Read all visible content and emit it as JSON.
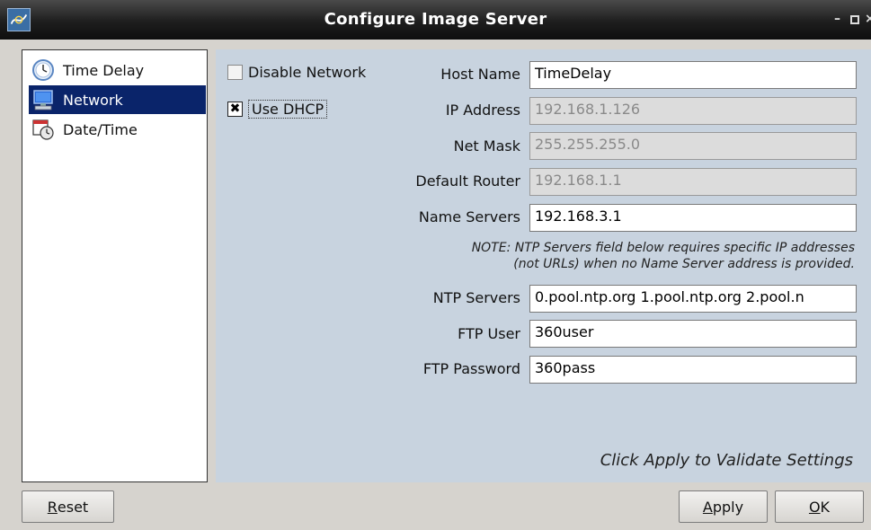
{
  "window": {
    "title": "Configure Image Server",
    "controls": {
      "minimize": "–",
      "maximize": "□",
      "close": "×"
    }
  },
  "sidebar": {
    "items": [
      {
        "label": "Time Delay",
        "icon": "clock-icon",
        "selected": false
      },
      {
        "label": "Network",
        "icon": "network-computer-icon",
        "selected": true
      },
      {
        "label": "Date/Time",
        "icon": "calendar-clock-icon",
        "selected": false
      }
    ]
  },
  "network": {
    "disable_network": {
      "label": "Disable Network",
      "checked": false
    },
    "use_dhcp": {
      "label": "Use DHCP",
      "checked": true,
      "mark": "✖"
    },
    "fields": {
      "host_name": {
        "label": "Host Name",
        "value": "TimeDelay",
        "enabled": true
      },
      "ip_address": {
        "label": "IP Address",
        "value": "192.168.1.126",
        "enabled": false
      },
      "net_mask": {
        "label": "Net Mask",
        "value": "255.255.255.0",
        "enabled": false
      },
      "default_router": {
        "label": "Default Router",
        "value": "192.168.1.1",
        "enabled": false
      },
      "name_servers": {
        "label": "Name Servers",
        "value": "192.168.3.1",
        "enabled": true
      },
      "ntp_servers": {
        "label": "NTP Servers",
        "value": "0.pool.ntp.org  1.pool.ntp.org  2.pool.n",
        "enabled": true
      },
      "ftp_user": {
        "label": "FTP User",
        "value": "360user",
        "enabled": true
      },
      "ftp_password": {
        "label": "FTP Password",
        "value": "360pass",
        "enabled": true
      }
    },
    "note_line1": "NOTE: NTP Servers field below requires specific IP addresses",
    "note_line2": "(not URLs) when no Name Server address is provided.",
    "hint": "Click Apply to Validate Settings"
  },
  "buttons": {
    "reset": {
      "mnemonic": "R",
      "rest": "eset"
    },
    "apply": {
      "mnemonic": "A",
      "rest": "pply"
    },
    "ok": {
      "mnemonic": "O",
      "rest": "K"
    }
  },
  "colors": {
    "selection": "#0a246a",
    "panel_background": "#c8d3df",
    "window_background": "#d6d3ce"
  }
}
